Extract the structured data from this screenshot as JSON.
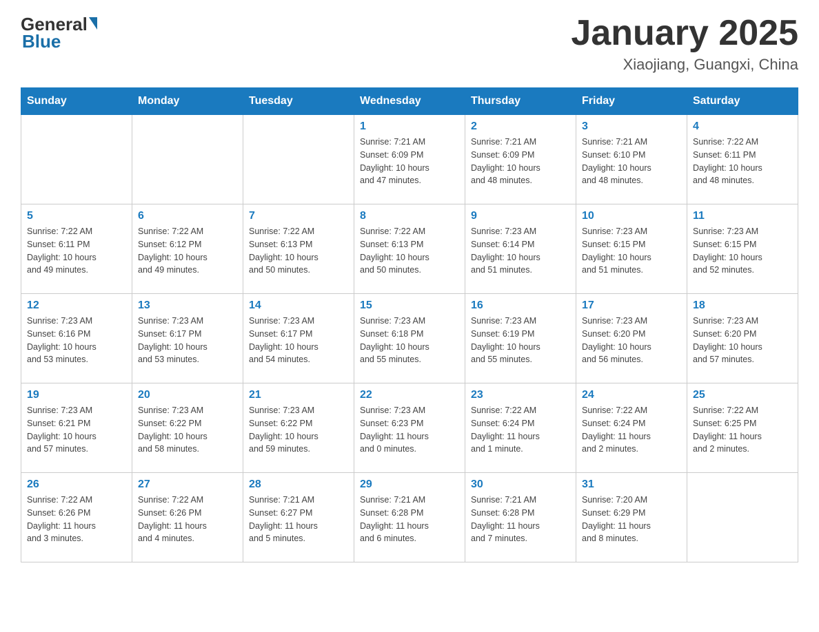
{
  "header": {
    "logo": {
      "general": "General",
      "blue": "Blue",
      "underline": "Blue"
    },
    "month_title": "January 2025",
    "location": "Xiaojiang, Guangxi, China"
  },
  "weekdays": [
    "Sunday",
    "Monday",
    "Tuesday",
    "Wednesday",
    "Thursday",
    "Friday",
    "Saturday"
  ],
  "weeks": [
    {
      "days": [
        {
          "num": "",
          "info": ""
        },
        {
          "num": "",
          "info": ""
        },
        {
          "num": "",
          "info": ""
        },
        {
          "num": "1",
          "info": "Sunrise: 7:21 AM\nSunset: 6:09 PM\nDaylight: 10 hours\nand 47 minutes."
        },
        {
          "num": "2",
          "info": "Sunrise: 7:21 AM\nSunset: 6:09 PM\nDaylight: 10 hours\nand 48 minutes."
        },
        {
          "num": "3",
          "info": "Sunrise: 7:21 AM\nSunset: 6:10 PM\nDaylight: 10 hours\nand 48 minutes."
        },
        {
          "num": "4",
          "info": "Sunrise: 7:22 AM\nSunset: 6:11 PM\nDaylight: 10 hours\nand 48 minutes."
        }
      ]
    },
    {
      "days": [
        {
          "num": "5",
          "info": "Sunrise: 7:22 AM\nSunset: 6:11 PM\nDaylight: 10 hours\nand 49 minutes."
        },
        {
          "num": "6",
          "info": "Sunrise: 7:22 AM\nSunset: 6:12 PM\nDaylight: 10 hours\nand 49 minutes."
        },
        {
          "num": "7",
          "info": "Sunrise: 7:22 AM\nSunset: 6:13 PM\nDaylight: 10 hours\nand 50 minutes."
        },
        {
          "num": "8",
          "info": "Sunrise: 7:22 AM\nSunset: 6:13 PM\nDaylight: 10 hours\nand 50 minutes."
        },
        {
          "num": "9",
          "info": "Sunrise: 7:23 AM\nSunset: 6:14 PM\nDaylight: 10 hours\nand 51 minutes."
        },
        {
          "num": "10",
          "info": "Sunrise: 7:23 AM\nSunset: 6:15 PM\nDaylight: 10 hours\nand 51 minutes."
        },
        {
          "num": "11",
          "info": "Sunrise: 7:23 AM\nSunset: 6:15 PM\nDaylight: 10 hours\nand 52 minutes."
        }
      ]
    },
    {
      "days": [
        {
          "num": "12",
          "info": "Sunrise: 7:23 AM\nSunset: 6:16 PM\nDaylight: 10 hours\nand 53 minutes."
        },
        {
          "num": "13",
          "info": "Sunrise: 7:23 AM\nSunset: 6:17 PM\nDaylight: 10 hours\nand 53 minutes."
        },
        {
          "num": "14",
          "info": "Sunrise: 7:23 AM\nSunset: 6:17 PM\nDaylight: 10 hours\nand 54 minutes."
        },
        {
          "num": "15",
          "info": "Sunrise: 7:23 AM\nSunset: 6:18 PM\nDaylight: 10 hours\nand 55 minutes."
        },
        {
          "num": "16",
          "info": "Sunrise: 7:23 AM\nSunset: 6:19 PM\nDaylight: 10 hours\nand 55 minutes."
        },
        {
          "num": "17",
          "info": "Sunrise: 7:23 AM\nSunset: 6:20 PM\nDaylight: 10 hours\nand 56 minutes."
        },
        {
          "num": "18",
          "info": "Sunrise: 7:23 AM\nSunset: 6:20 PM\nDaylight: 10 hours\nand 57 minutes."
        }
      ]
    },
    {
      "days": [
        {
          "num": "19",
          "info": "Sunrise: 7:23 AM\nSunset: 6:21 PM\nDaylight: 10 hours\nand 57 minutes."
        },
        {
          "num": "20",
          "info": "Sunrise: 7:23 AM\nSunset: 6:22 PM\nDaylight: 10 hours\nand 58 minutes."
        },
        {
          "num": "21",
          "info": "Sunrise: 7:23 AM\nSunset: 6:22 PM\nDaylight: 10 hours\nand 59 minutes."
        },
        {
          "num": "22",
          "info": "Sunrise: 7:23 AM\nSunset: 6:23 PM\nDaylight: 11 hours\nand 0 minutes."
        },
        {
          "num": "23",
          "info": "Sunrise: 7:22 AM\nSunset: 6:24 PM\nDaylight: 11 hours\nand 1 minute."
        },
        {
          "num": "24",
          "info": "Sunrise: 7:22 AM\nSunset: 6:24 PM\nDaylight: 11 hours\nand 2 minutes."
        },
        {
          "num": "25",
          "info": "Sunrise: 7:22 AM\nSunset: 6:25 PM\nDaylight: 11 hours\nand 2 minutes."
        }
      ]
    },
    {
      "days": [
        {
          "num": "26",
          "info": "Sunrise: 7:22 AM\nSunset: 6:26 PM\nDaylight: 11 hours\nand 3 minutes."
        },
        {
          "num": "27",
          "info": "Sunrise: 7:22 AM\nSunset: 6:26 PM\nDaylight: 11 hours\nand 4 minutes."
        },
        {
          "num": "28",
          "info": "Sunrise: 7:21 AM\nSunset: 6:27 PM\nDaylight: 11 hours\nand 5 minutes."
        },
        {
          "num": "29",
          "info": "Sunrise: 7:21 AM\nSunset: 6:28 PM\nDaylight: 11 hours\nand 6 minutes."
        },
        {
          "num": "30",
          "info": "Sunrise: 7:21 AM\nSunset: 6:28 PM\nDaylight: 11 hours\nand 7 minutes."
        },
        {
          "num": "31",
          "info": "Sunrise: 7:20 AM\nSunset: 6:29 PM\nDaylight: 11 hours\nand 8 minutes."
        },
        {
          "num": "",
          "info": ""
        }
      ]
    }
  ]
}
